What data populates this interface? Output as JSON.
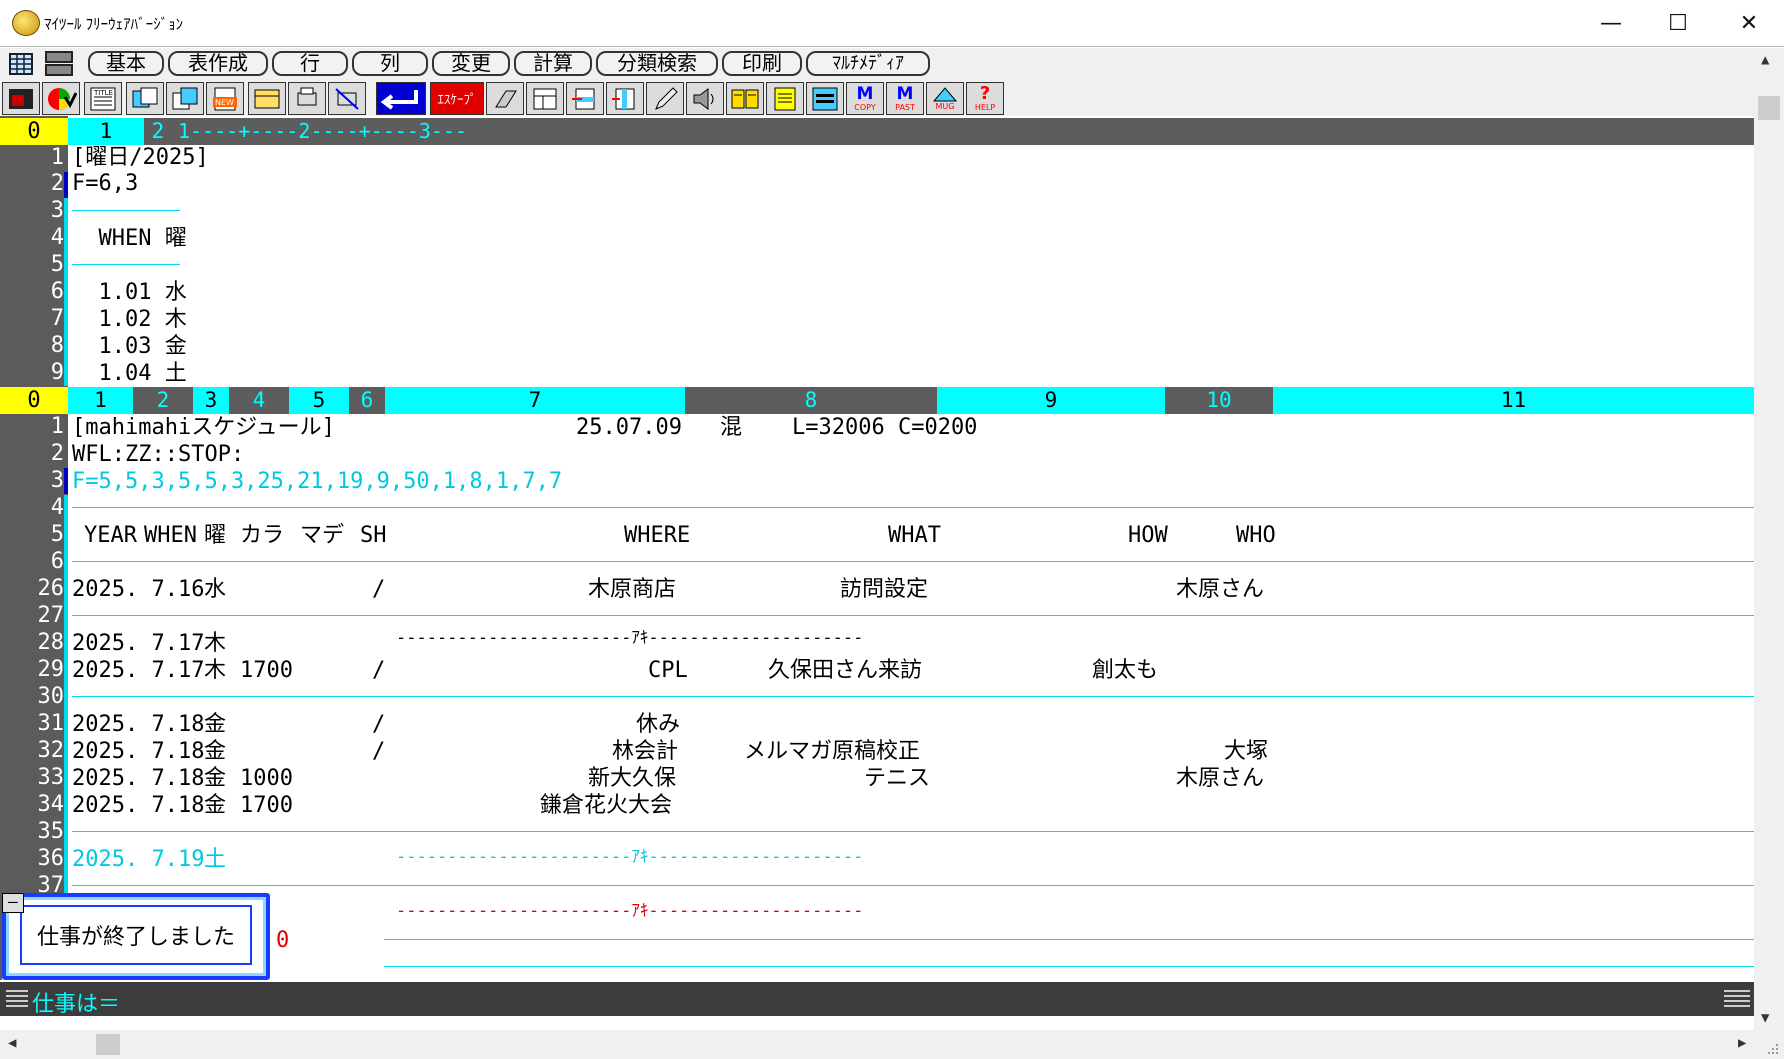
{
  "window": {
    "title": "ﾏｲﾂｰﾙ ﾌﾘｰｳｪｱﾊﾞｰｼﾞｮﾝ",
    "minimize": "—",
    "maximize": "☐",
    "close": "✕"
  },
  "menu": [
    "基本",
    "表作成",
    "行",
    "列",
    "変更",
    "計算",
    "分類検索",
    "印刷",
    "ﾏﾙﾁﾒﾃﾞｨｱ"
  ],
  "toolbar": {
    "esc_label": "ｴｽｹｰﾌﾟ",
    "copy_label": "COPY",
    "past_label": "PAST",
    "mug_label": "MUG",
    "help_label": "HELP"
  },
  "top_pane": {
    "ruler": {
      "zero": "0",
      "s1": "1",
      "s2": "2",
      "marks": "1----+----2----+----3---"
    },
    "line_numbers": [
      "1",
      "2",
      "3",
      "4",
      "5",
      "6",
      "7",
      "8",
      "9"
    ],
    "lines": [
      "[曜日/2025]",
      "F=6,3",
      "",
      "  WHEN 曜",
      "",
      "  1.01 水",
      "  1.02 木",
      "  1.03 金",
      "  1.04 土"
    ]
  },
  "bottom_pane": {
    "ruler": {
      "zero": "0",
      "cols": [
        "1",
        "2",
        "3",
        "4",
        "5",
        "6",
        "7",
        "8",
        "9",
        "10",
        "11"
      ]
    },
    "header": {
      "title": "[mahimahiスケジュール]",
      "date": "25.07.09",
      "mode": "混",
      "info": "L=32006 C=0200"
    },
    "line_numbers": [
      "1",
      "2",
      "3",
      "4",
      "5",
      "6",
      "26",
      "27",
      "28",
      "29",
      "30",
      "31",
      "32",
      "33",
      "34",
      "35",
      "36",
      "37"
    ],
    "wfl": "WFL:ZZ::STOP:",
    "format": "F=5,5,3,5,5,3,25,21,19,9,50,1,8,1,7,7",
    "columns": {
      "year": "YEAR",
      "when": "WHEN",
      "day": "曜",
      "kara": "カラ",
      "made": "マデ",
      "sh": "SH",
      "where": "WHERE",
      "what": "WHAT",
      "how": "HOW",
      "who": "WHO"
    },
    "rows": [
      {
        "ln": "26",
        "date": "2025. 7.16",
        "day": "水",
        "kara": "",
        "sh": "/",
        "where": "木原商店",
        "what": "訪問設定",
        "how": "",
        "who": "木原さん"
      },
      {
        "ln": "28",
        "date": "2025. 7.17",
        "day": "木",
        "kara": "",
        "sh": "",
        "where": "",
        "what": "",
        "how": "",
        "who": ""
      },
      {
        "ln": "29",
        "date": "2025. 7.17",
        "day": "木",
        "kara": "1700",
        "sh": "/",
        "where": "CPL",
        "what": "久保田さん来訪",
        "how": "創太も",
        "who": ""
      },
      {
        "ln": "31",
        "date": "2025. 7.18",
        "day": "金",
        "kara": "",
        "sh": "/",
        "where": "休み",
        "what": "",
        "how": "",
        "who": ""
      },
      {
        "ln": "32",
        "date": "2025. 7.18",
        "day": "金",
        "kara": "",
        "sh": "/",
        "where": "林会計",
        "what": "メルマガ原稿校正",
        "how": "",
        "who": "大塚"
      },
      {
        "ln": "33",
        "date": "2025. 7.18",
        "day": "金",
        "kara": "1000",
        "sh": "",
        "where": "新大久保",
        "what": "テニス",
        "how": "",
        "who": "木原さん"
      },
      {
        "ln": "34",
        "date": "2025. 7.18",
        "day": "金",
        "kara": "1700",
        "sh": "",
        "where": "鎌倉花火大会",
        "what": "",
        "how": "",
        "who": ""
      },
      {
        "ln": "36",
        "date": "2025. 7.19",
        "day": "土",
        "kara": "",
        "sh": "",
        "where": "",
        "what": "",
        "how": "",
        "who": ""
      }
    ],
    "aki_label": "ｱｷ"
  },
  "dialog": {
    "message": "仕事が終了しました",
    "count": "0",
    "minus": "—"
  },
  "status": {
    "prompt": "仕事は＝"
  },
  "colors": {
    "cyan": "#00ffff",
    "dark_gray": "#5d5d5d",
    "yellow": "#ffff00",
    "dialog_blue": "#1a3cff",
    "red": "#e00000"
  }
}
